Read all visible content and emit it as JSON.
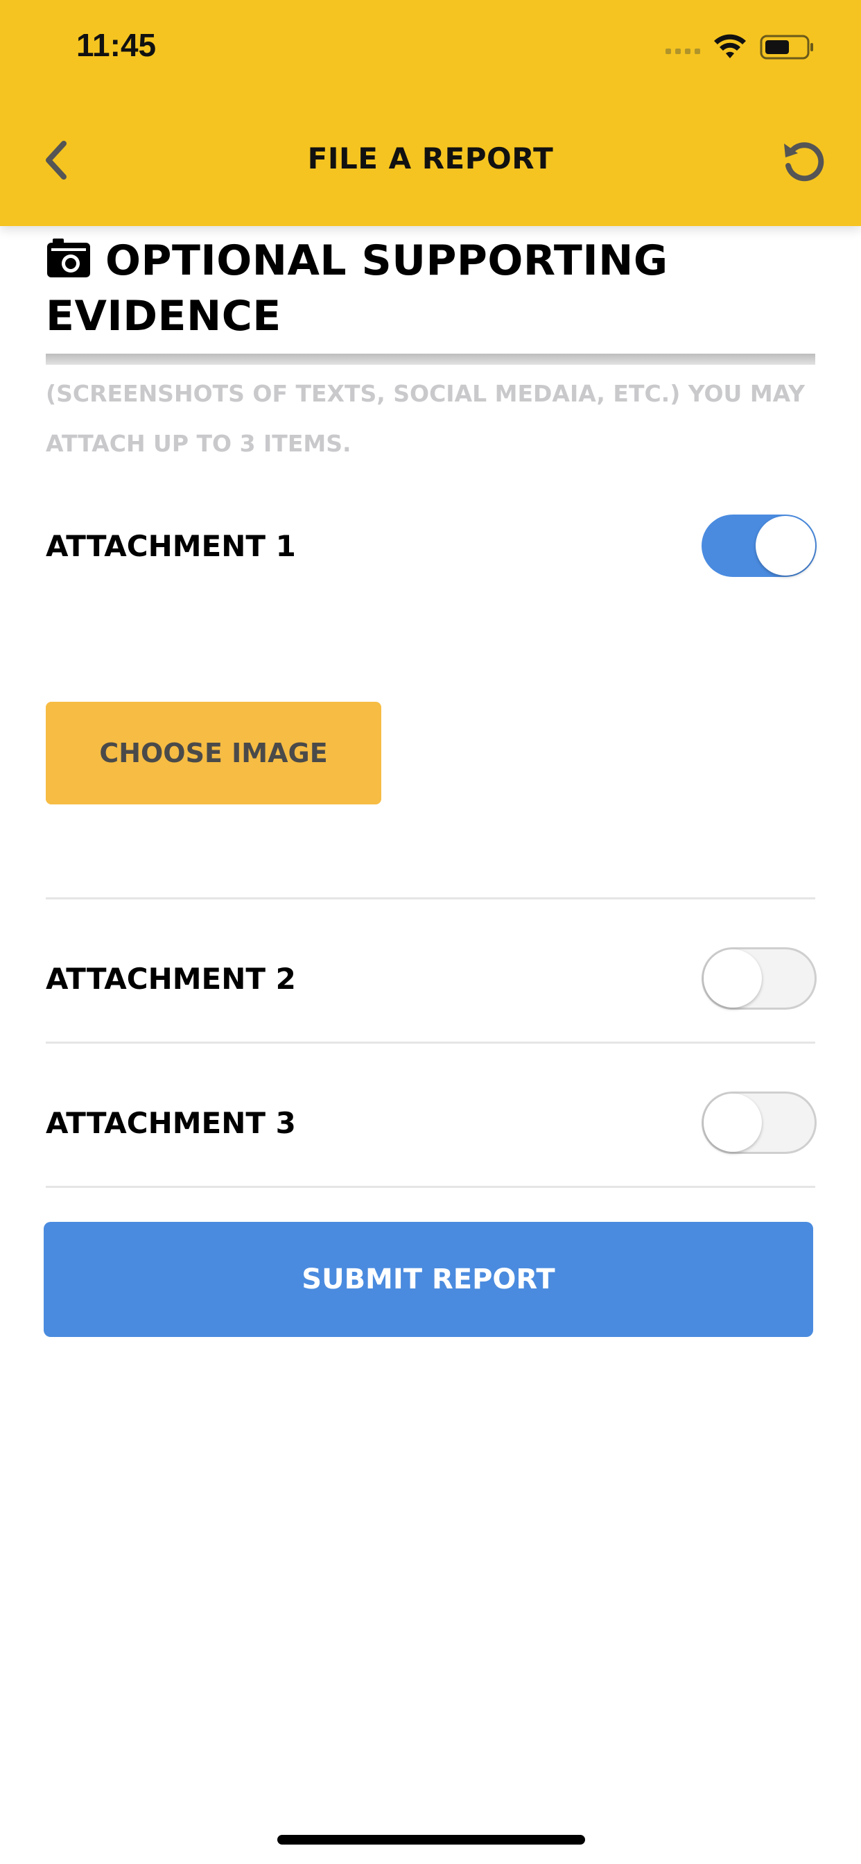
{
  "status_bar": {
    "time": "11:45"
  },
  "nav": {
    "title": "FILE A REPORT",
    "back_icon": "chevron-left-icon",
    "refresh_icon": "refresh-icon"
  },
  "section": {
    "icon": "camera-icon",
    "title": "OPTIONAL SUPPORTING EVIDENCE",
    "subtext": "(SCREENSHOTS OF TEXTS, SOCIAL MEDAIA, ETC.) YOU MAY ATTACH UP TO 3 ITEMS."
  },
  "attachments": [
    {
      "label": "ATTACHMENT 1",
      "enabled": true
    },
    {
      "label": "ATTACHMENT 2",
      "enabled": false
    },
    {
      "label": "ATTACHMENT 3",
      "enabled": false
    }
  ],
  "choose_image_label": "CHOOSE IMAGE",
  "submit_label": "SUBMIT REPORT",
  "colors": {
    "header": "#F5C420",
    "choose_button": "#F6BC43",
    "accent_blue": "#4A8BDF",
    "subtext": "#C9C9CC"
  }
}
